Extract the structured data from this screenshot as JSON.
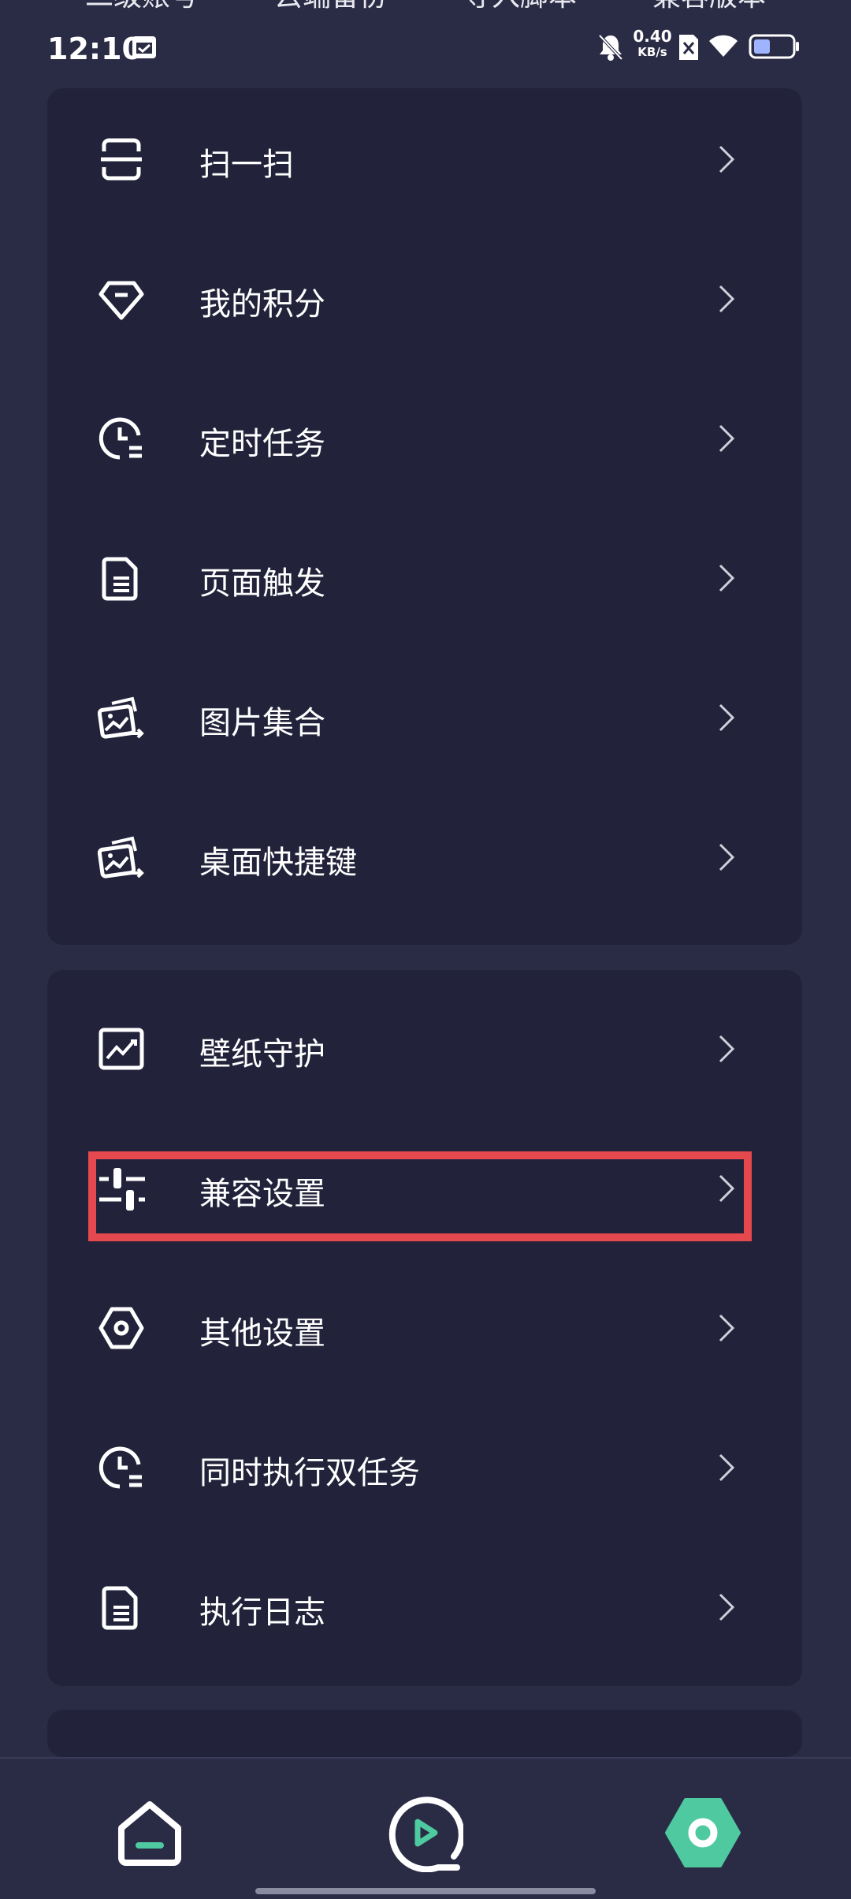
{
  "top_tabs": [
    "二级账号",
    "云端备份",
    "导入脚本",
    "兼容版本"
  ],
  "status_bar": {
    "time": "12:10",
    "net_speed_value": "0.40",
    "net_speed_unit": "KB/s",
    "icons": [
      "calendar-icon",
      "bell-off-icon",
      "sim-x-icon",
      "wifi-icon",
      "battery-icon"
    ]
  },
  "menu_group_1": [
    {
      "label": "扫一扫",
      "icon": "scan-icon"
    },
    {
      "label": "我的积分",
      "icon": "diamond-icon"
    },
    {
      "label": "定时任务",
      "icon": "clock-list-icon"
    },
    {
      "label": "页面触发",
      "icon": "document-icon"
    },
    {
      "label": "图片集合",
      "icon": "image-collection-icon"
    },
    {
      "label": "桌面快捷键",
      "icon": "image-collection-icon"
    }
  ],
  "menu_group_2": [
    {
      "label": "壁纸守护",
      "icon": "wallpaper-icon"
    },
    {
      "label": "兼容设置",
      "icon": "sliders-icon"
    },
    {
      "label": "其他设置",
      "icon": "hexagon-settings-icon"
    },
    {
      "label": "同时执行双任务",
      "icon": "clock-list-icon"
    },
    {
      "label": "执行日志",
      "icon": "document-icon"
    }
  ],
  "bottom_nav": [
    {
      "name": "home",
      "icon": "home-icon"
    },
    {
      "name": "run",
      "icon": "play-circle-icon"
    },
    {
      "name": "settings",
      "icon": "hexagon-settings-icon",
      "active": true
    }
  ],
  "colors": {
    "background": "#2a2b45",
    "card": "#22233a",
    "accent": "#4fc9a0",
    "highlight": "#e5484d"
  }
}
